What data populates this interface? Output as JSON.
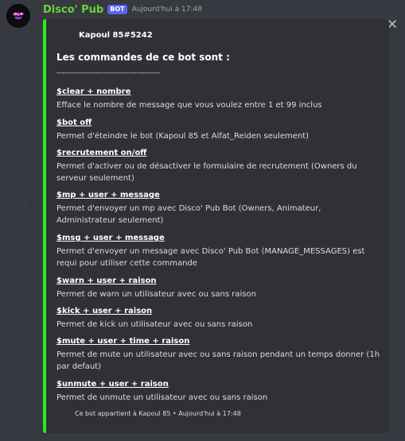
{
  "message": {
    "username": "Disco' Pub",
    "bot_tag": "BOT",
    "timestamp": "Aujourd'hui à 17:48"
  },
  "embed": {
    "accent_color": "#28ec1d",
    "author": "Kapoul 85#5242",
    "title": "Les commandes de ce bot sont :",
    "separator": "----------------------------------------",
    "commands": [
      {
        "name": "$clear + nombre",
        "desc": "Efface le nombre de message que vous voulez entre 1 et 99 inclus"
      },
      {
        "name": "$bot off",
        "desc": "Permet d'éteindre le bot (Kapoul 85 et Alfat_Reiden seulement)"
      },
      {
        "name": "$recrutement on/off",
        "desc": "Permet d'activer ou de désactiver le formulaire de recrutement (Owners du serveur seulement)"
      },
      {
        "name": "$mp + user + message",
        "desc": "Permet d'envoyer un mp avec Disco' Pub Bot (Owners, Animateur, Administrateur seulement)"
      },
      {
        "name": "$msg + user + message",
        "desc": "Permet d'envoyer un message avec Disco' Pub Bot (MANAGE_MESSAGES) est requi pour utiliser cette commande"
      },
      {
        "name": "$warn + user + raison",
        "desc": "Permet de warn un utilisateur avec ou sans raison"
      },
      {
        "name": "$kick + user + raison",
        "desc": "Permet de kick un utilisateur avec ou sans raison"
      },
      {
        "name": "$mute + user + time + raison",
        "desc": "Permet de mute un utilisateur avec ou sans raison pendant un temps donner (1h par defaut)"
      },
      {
        "name": "$unmute + user + raison",
        "desc": "Permet de unmute un utilisateur avec ou sans raison"
      }
    ],
    "footer": "Ce bot appartient à Kapoul 85 • Aujourd'hui à 17:48"
  },
  "icons": {
    "avatar": "bot-avatar-icon",
    "close": "close-icon"
  }
}
